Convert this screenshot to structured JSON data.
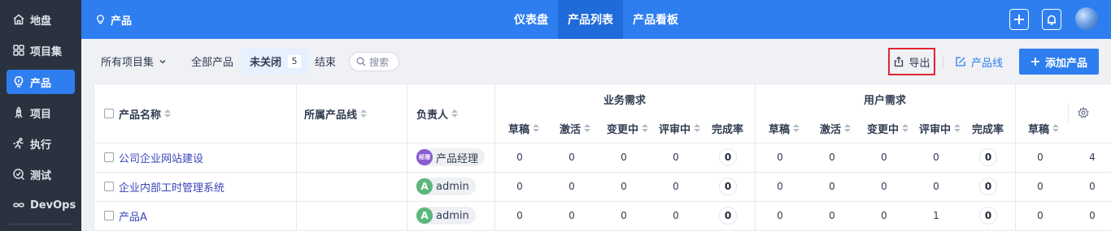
{
  "sidebar": {
    "items": [
      {
        "label": "地盘",
        "icon": "home-icon",
        "active": false
      },
      {
        "label": "项目集",
        "icon": "grid-icon",
        "active": false
      },
      {
        "label": "产品",
        "icon": "lightbulb-icon",
        "active": true
      },
      {
        "label": "项目",
        "icon": "rocket-icon",
        "active": false
      },
      {
        "label": "执行",
        "icon": "run-icon",
        "active": false
      },
      {
        "label": "测试",
        "icon": "test-icon",
        "active": false
      },
      {
        "label": "DevOps",
        "icon": "infinity-icon",
        "active": false
      }
    ]
  },
  "header": {
    "title": "产品",
    "tabs": [
      {
        "label": "仪表盘",
        "active": false
      },
      {
        "label": "产品列表",
        "active": true
      },
      {
        "label": "产品看板",
        "active": false
      }
    ]
  },
  "toolbar": {
    "program_filter": "所有项目集",
    "filters": [
      {
        "label": "全部产品",
        "active": false
      },
      {
        "label": "未关闭",
        "active": true,
        "count": "5"
      },
      {
        "label": "结束",
        "active": false
      }
    ],
    "search_label": "搜索",
    "export_label": "导出",
    "product_line_label": "产品线",
    "add_label": "添加产品"
  },
  "table": {
    "headers": {
      "name": "产品名称",
      "line": "所属产品线",
      "owner": "负责人",
      "biz_group": "业务需求",
      "user_group": "用户需求",
      "sub": [
        "草稿",
        "激活",
        "变更中",
        "评审中",
        "完成率"
      ],
      "extra": "草稿"
    },
    "rows": [
      {
        "name": "公司企业网站建设",
        "owner": "产品经理",
        "owner_avatar": "经理",
        "owner_color": "#8a5cd1",
        "biz": [
          "0",
          "0",
          "0",
          "0",
          "0"
        ],
        "user": [
          "0",
          "0",
          "0",
          "0",
          "0"
        ],
        "extra": [
          "0",
          "4"
        ]
      },
      {
        "name": "企业内部工时管理系统",
        "owner": "admin",
        "owner_avatar": "A",
        "owner_color": "#5bb77a",
        "biz": [
          "0",
          "0",
          "0",
          "0",
          "0"
        ],
        "user": [
          "0",
          "0",
          "0",
          "0",
          "0"
        ],
        "extra": [
          "0",
          "0"
        ]
      },
      {
        "name": "产品A",
        "owner": "admin",
        "owner_avatar": "A",
        "owner_color": "#5bb77a",
        "biz": [
          "0",
          "0",
          "0",
          "0",
          "0"
        ],
        "user": [
          "0",
          "0",
          "0",
          "1",
          "0"
        ],
        "extra": [
          "0",
          "0"
        ]
      }
    ]
  },
  "colors": {
    "primary": "#2e7ef0",
    "sidebar_bg": "#2b323f",
    "export_highlight": "#e0262d"
  }
}
